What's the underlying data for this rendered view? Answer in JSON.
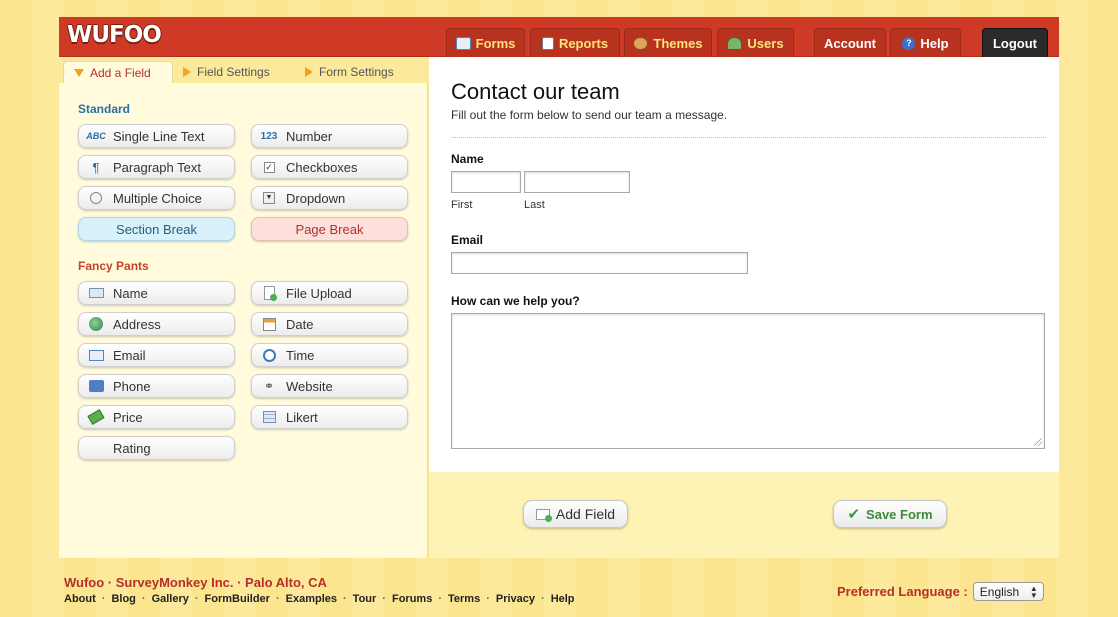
{
  "app": {
    "logo_text": "WUFOO",
    "nav": {
      "forms": "Forms",
      "reports": "Reports",
      "themes": "Themes",
      "users": "Users",
      "account": "Account",
      "help": "Help",
      "logout": "Logout"
    }
  },
  "builder": {
    "tabs": {
      "add_field": "Add a Field",
      "field_settings": "Field Settings",
      "form_settings": "Form Settings"
    },
    "standard": {
      "heading": "Standard",
      "single_line_text": "Single Line Text",
      "number": "Number",
      "paragraph_text": "Paragraph Text",
      "checkboxes": "Checkboxes",
      "multiple_choice": "Multiple Choice",
      "dropdown": "Dropdown",
      "section_break": "Section Break",
      "page_break": "Page Break"
    },
    "fancy": {
      "heading": "Fancy Pants",
      "name": "Name",
      "file_upload": "File Upload",
      "address": "Address",
      "date": "Date",
      "email": "Email",
      "time": "Time",
      "phone": "Phone",
      "website": "Website",
      "price": "Price",
      "likert": "Likert",
      "rating": "Rating"
    },
    "icons": {
      "abc": "ABC",
      "num": "123",
      "para": "¶"
    }
  },
  "form": {
    "title": "Contact our team",
    "description": "Fill out the form below to send our team a message.",
    "name_label": "Name",
    "first_label": "First",
    "last_label": "Last",
    "email_label": "Email",
    "help_label": "How can we help you?"
  },
  "actions": {
    "add_field": "Add Field",
    "save_form": "Save Form"
  },
  "footer": {
    "line1": "Wufoo · SurveyMonkey Inc. · Palo Alto, CA",
    "links": [
      "About",
      "Blog",
      "Gallery",
      "FormBuilder",
      "Examples",
      "Tour",
      "Forums",
      "Terms",
      "Privacy",
      "Help"
    ],
    "language_label": "Preferred Language :",
    "language_value": "English"
  },
  "colors": {
    "brand_red": "#cf3a26",
    "tab_yellow_text": "#ffe27a",
    "section_blue": "#2a6fa8",
    "fancy_red": "#c8402a"
  }
}
